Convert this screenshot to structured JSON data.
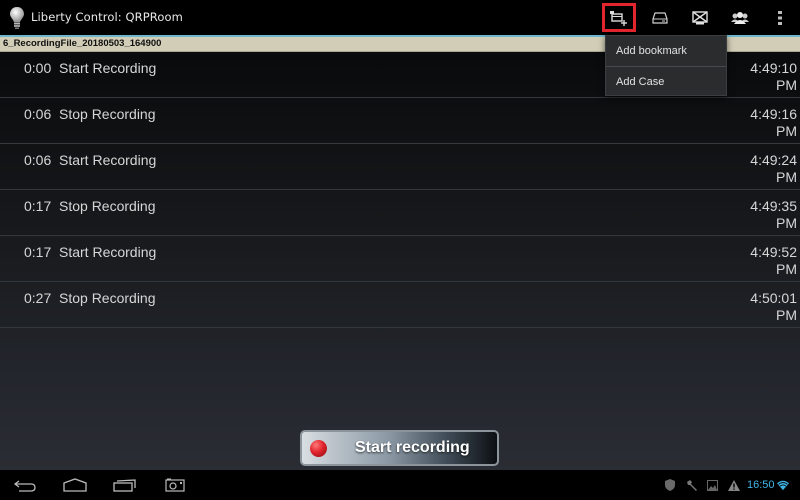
{
  "app": {
    "title": "Liberty Control: QRPRoom",
    "icon": "lightbulb-icon"
  },
  "action_bar": {
    "buttons": [
      {
        "name": "add-bookmark-menu-button",
        "icon": "add-layer-icon",
        "selected": true
      },
      {
        "name": "storage-button",
        "icon": "hard-drive-icon",
        "selected": false
      },
      {
        "name": "display-button",
        "icon": "monitor-cross-icon",
        "selected": false
      },
      {
        "name": "participants-button",
        "icon": "people-group-icon",
        "selected": false
      },
      {
        "name": "overflow-menu-button",
        "icon": "more-vertical-icon",
        "selected": false
      }
    ]
  },
  "file_bar": {
    "file_name": "6_RecordingFile_20180503_164900"
  },
  "dropdown_menu": {
    "items": [
      {
        "label": "Add bookmark"
      },
      {
        "label": "Add Case"
      }
    ]
  },
  "events": [
    {
      "offset": "0:00",
      "event": "Start Recording",
      "time": "4:49:10",
      "ampm": "PM"
    },
    {
      "offset": "0:06",
      "event": "Stop Recording",
      "time": "4:49:16",
      "ampm": "PM"
    },
    {
      "offset": "0:06",
      "event": "Start Recording",
      "time": "4:49:24",
      "ampm": "PM"
    },
    {
      "offset": "0:17",
      "event": "Stop Recording",
      "time": "4:49:35",
      "ampm": "PM"
    },
    {
      "offset": "0:17",
      "event": "Start Recording",
      "time": "4:49:52",
      "ampm": "PM"
    },
    {
      "offset": "0:27",
      "event": "Stop Recording",
      "time": "4:50:01",
      "ampm": "PM"
    }
  ],
  "record_button": {
    "label": "Start recording",
    "indicator_color": "#e0232b"
  },
  "nav_bar": {
    "buttons": [
      "back-icon",
      "home-icon",
      "recent-apps-icon",
      "screenshot-icon"
    ]
  },
  "status_bar": {
    "icons": [
      "shield-icon",
      "wrench-icon",
      "image-icon",
      "warning-icon"
    ],
    "clock": "16:50",
    "wifi": "wifi-icon"
  },
  "colors": {
    "accent_line": "#6cb7cc",
    "file_bar_bg": "#d1cdb6",
    "selection_outline": "#e3252d",
    "clock": "#3fb5e5"
  }
}
